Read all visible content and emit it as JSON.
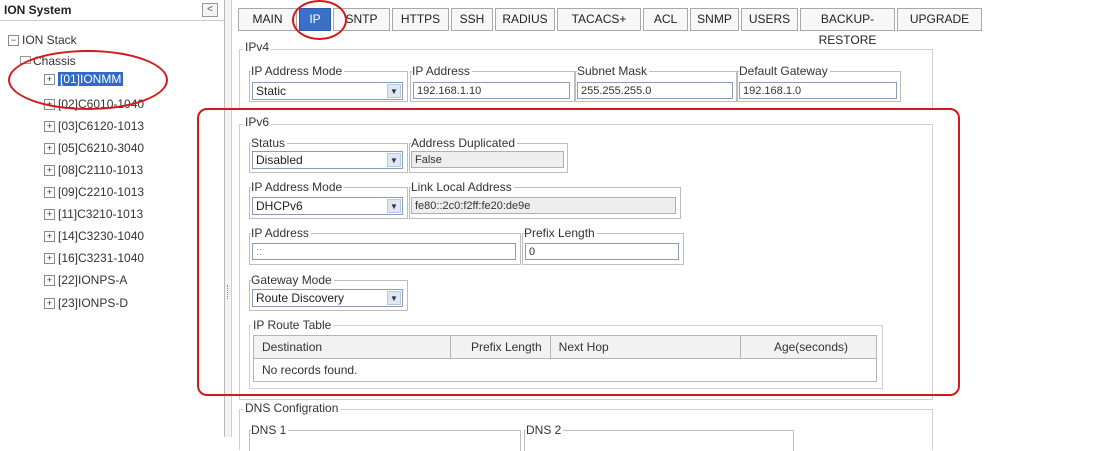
{
  "tree": {
    "title": "ION System",
    "collapse": "<",
    "root": "ION Stack",
    "chassis": "Chassis",
    "items": [
      "[01]IONMM",
      "[02]C6010-1040",
      "[03]C6120-1013",
      "[05]C6210-3040",
      "[08]C2110-1013",
      "[09]C2210-1013",
      "[11]C3210-1013",
      "[14]C3230-1040",
      "[16]C3231-1040",
      "[22]IONPS-A",
      "[23]IONPS-D"
    ]
  },
  "tabs": [
    "MAIN",
    "IP",
    "SNTP",
    "HTTPS",
    "SSH",
    "RADIUS",
    "TACACS+",
    "ACL",
    "SNMP",
    "USERS",
    "BACKUP-RESTORE",
    "UPGRADE"
  ],
  "active_tab": "IP",
  "ipv4": {
    "legend": "IPv4",
    "mode_label": "IP Address Mode",
    "mode_value": "Static",
    "ip_label": "IP Address",
    "ip_value": "192.168.1.10",
    "mask_label": "Subnet Mask",
    "mask_value": "255.255.255.0",
    "gw_label": "Default Gateway",
    "gw_value": "192.168.1.0"
  },
  "ipv6": {
    "legend": "IPv6",
    "status_label": "Status",
    "status_value": "Disabled",
    "dup_label": "Address Duplicated",
    "dup_value": "False",
    "mode_label": "IP Address Mode",
    "mode_value": "DHCPv6",
    "lla_label": "Link Local Address",
    "lla_value": "fe80::2c0:f2ff:fe20:de9e",
    "ip_label": "IP Address",
    "ip_value": "::",
    "prefix_label": "Prefix Length",
    "prefix_value": "0",
    "gwmode_label": "Gateway Mode",
    "gwmode_value": "Route Discovery",
    "route_legend": "IP Route Table",
    "columns": [
      "Destination",
      "Prefix Length",
      "Next Hop",
      "Age(seconds)"
    ],
    "empty": "No records found."
  },
  "dns": {
    "legend": "DNS Configration",
    "dns1_label": "DNS 1",
    "dns2_label": "DNS 2"
  },
  "colors": {
    "annotation": "#d4191d",
    "active_tab": "#3a70c8",
    "selection": "#316ac5"
  }
}
